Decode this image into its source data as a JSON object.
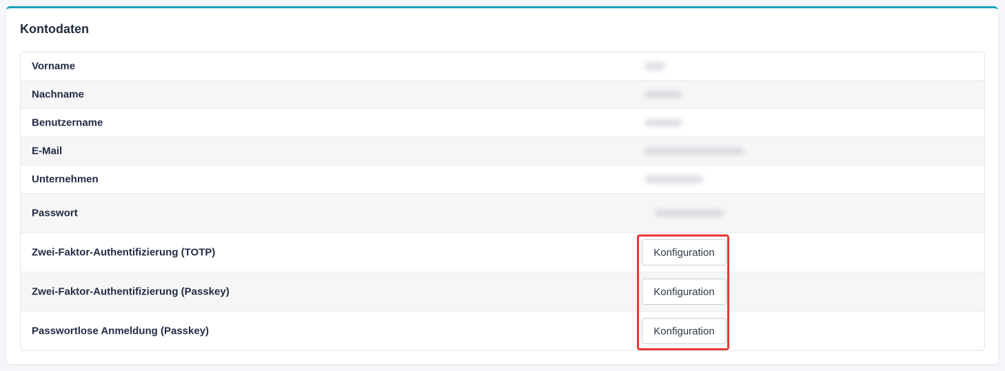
{
  "card": {
    "title": "Kontodaten",
    "accent_color": "#17a2b8"
  },
  "rows": [
    {
      "label": "Vorname"
    },
    {
      "label": "Nachname"
    },
    {
      "label": "Benutzername"
    },
    {
      "label": "E-Mail"
    },
    {
      "label": "Unternehmen"
    },
    {
      "label": "Passwort"
    },
    {
      "label": "Zwei-Faktor-Authentifizierung (TOTP)",
      "button": "Konfiguration"
    },
    {
      "label": "Zwei-Faktor-Authentifizierung (Passkey)",
      "button": "Konfiguration"
    },
    {
      "label": "Passwortlose Anmeldung (Passkey)",
      "button": "Konfiguration"
    }
  ],
  "highlight_color": "#e53935"
}
